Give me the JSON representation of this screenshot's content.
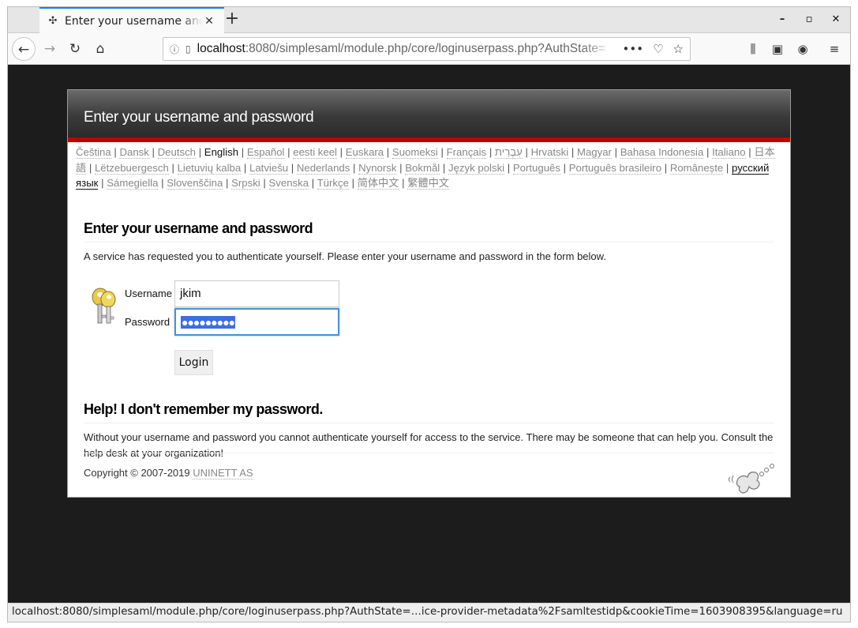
{
  "browser": {
    "tab_title": "Enter your username and password",
    "url_host": "localhost",
    "url_rest": ":8080/simplesaml/module.php/core/loginuserpass.php?AuthState=",
    "status_url": "localhost:8080/simplesaml/module.php/core/loginuserpass.php?AuthState=…ice-provider-metadata%2Fsamltestidp&cookieTime=1603908395&language=ru"
  },
  "page": {
    "header_title": "Enter your username and password",
    "languages": [
      "Čeština",
      "Dansk",
      "Deutsch",
      "English",
      "Español",
      "eesti keel",
      "Euskara",
      "Suomeksi",
      "Français",
      "עִבְרִית",
      "Hrvatski",
      "Magyar",
      "Bahasa Indonesia",
      "Italiano",
      "日本語",
      "Lëtzebuergesch",
      "Lietuvių kalba",
      "Latviešu",
      "Nederlands",
      "Nynorsk",
      "Bokmål",
      "Język polski",
      "Português",
      "Português brasileiro",
      "Românește",
      "русский язык",
      "Sámegiella",
      "Slovenščina",
      "Srpski",
      "Svenska",
      "Türkçe",
      "简体中文",
      "繁體中文"
    ],
    "login_heading": "Enter your username and password",
    "login_intro": "A service has requested you to authenticate yourself. Please enter your username and password in the form below.",
    "username_label": "Username",
    "username_value": "jkim",
    "password_label": "Password",
    "password_mask": "●●●●●●●●●",
    "login_button": "Login",
    "help_heading": "Help! I don't remember my password.",
    "help_text": "Without your username and password you cannot authenticate yourself for access to the service. There may be someone that can help you. Consult the help desk at your organization!",
    "copyright_prefix": "Copyright © 2007-2019 ",
    "copyright_link": "UNINETT AS"
  },
  "colors": {
    "header_bar": "#c00000",
    "focus_ring": "#4a90d9",
    "selection": "#3c6ee0"
  }
}
